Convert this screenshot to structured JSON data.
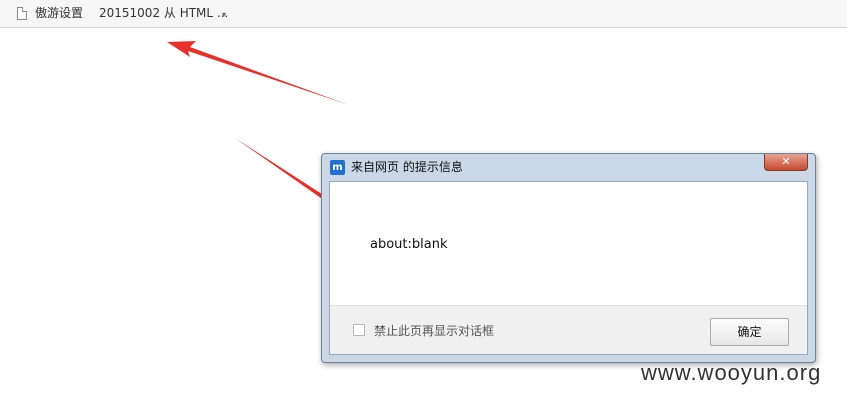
{
  "bookmark_bar": {
    "items": [
      {
        "label": "傲游设置"
      },
      {
        "label": "20151002 从 HTML ..."
      }
    ],
    "overflow_arrow": "▾"
  },
  "dialog": {
    "icon_letter": "m",
    "title": "来自网页 的提示信息",
    "close_symbol": "✕",
    "message": "about:blank",
    "checkbox_label": "禁止此页再显示对话框",
    "checkbox_checked": false,
    "ok_label": "确定"
  },
  "annotation_color": "#e8302a",
  "watermark": "www.wooyun.org"
}
